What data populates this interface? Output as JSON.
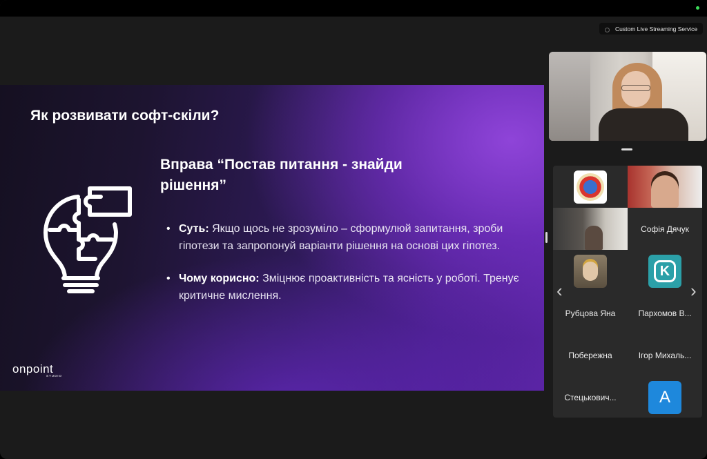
{
  "stream": {
    "label": "Custom Live Streaming Service"
  },
  "slide": {
    "title": "Як розвивати софт-скіли?",
    "exercise_title": "Вправа “Постав питання - знайди рішення”",
    "bullets": [
      {
        "label": "Суть:",
        "text": " Якщо щось не зрозуміло – сформулюй запитання, зроби гіпотези та запропонуй варіанти рішення на основі цих гіпотез."
      },
      {
        "label": "Чому корисно:",
        "text": " Зміцнює проактивність та ясність у роботі. Тренує критичне мислення."
      }
    ],
    "logo": {
      "word": "onpoint",
      "sub": "STUDIO"
    }
  },
  "gallery": {
    "participants": [
      {
        "name": "Софія Дячук"
      },
      {
        "name": "Рубцова Яна"
      },
      {
        "name": "Пархомов В..."
      },
      {
        "name": "Побережна"
      },
      {
        "name": "Ігор Михаль..."
      },
      {
        "name": "Стецькович..."
      }
    ],
    "avatar_letter": "A",
    "avatar_color": "#1e88dc",
    "prev_arrow": "‹",
    "next_arrow": "›"
  },
  "colors": {
    "status_dot": "#3ddc5a",
    "slide_accent": "#5a24a4"
  }
}
